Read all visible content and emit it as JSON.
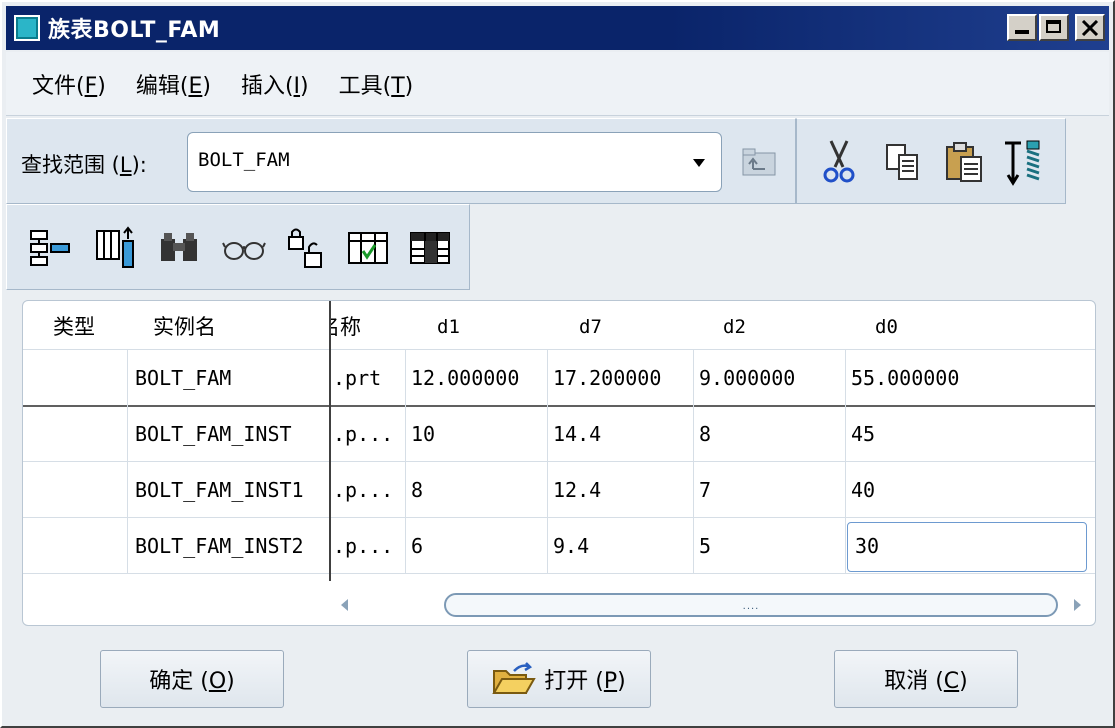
{
  "window": {
    "title": "族表BOLT_FAM",
    "controls": [
      "minimize",
      "maximize",
      "close"
    ]
  },
  "menubar": {
    "items": [
      {
        "label": "文件(",
        "acc": "F",
        "end": ")"
      },
      {
        "label": "编辑(",
        "acc": "E",
        "end": ")"
      },
      {
        "label": "插入(",
        "acc": "I",
        "end": ")"
      },
      {
        "label": "工具(",
        "acc": "T",
        "end": ")"
      }
    ]
  },
  "toolbar": {
    "search_label": "查找范围 (",
    "search_acc": "L",
    "search_end": "):",
    "search_value": "BOLT_FAM",
    "icons": [
      "up-folder-icon",
      "cut-icon",
      "copy-icon",
      "paste-icon",
      "bolt-fill-icon"
    ],
    "row2_icons": [
      "insert-column-icon",
      "insert-row-icon",
      "find-icon",
      "glasses-icon",
      "lock-icon",
      "verify-icon",
      "table-icon"
    ]
  },
  "table": {
    "headers": [
      "类型",
      "实例名",
      "名称",
      "d1",
      "d7",
      "d2",
      "d0"
    ],
    "rows": [
      [
        "",
        "BOLT_FAM",
        ".prt",
        "12.000000",
        "17.200000",
        "9.000000",
        "55.000000"
      ],
      [
        "",
        "BOLT_FAM_INST",
        ".p...",
        "10",
        "14.4",
        "8",
        "45"
      ],
      [
        "",
        "BOLT_FAM_INST1",
        ".p...",
        "8",
        "12.4",
        "7",
        "40"
      ],
      [
        "",
        "BOLT_FAM_INST2",
        ".p...",
        "6",
        "9.4",
        "5",
        "30"
      ]
    ],
    "scrollbar_grip": "...."
  },
  "buttons": {
    "ok": {
      "label": "确定 (",
      "acc": "O",
      "end": ")"
    },
    "open": {
      "label": "打开 (",
      "acc": "P",
      "end": ")"
    },
    "cancel": {
      "label": "取消 (",
      "acc": "C",
      "end": ")"
    }
  }
}
